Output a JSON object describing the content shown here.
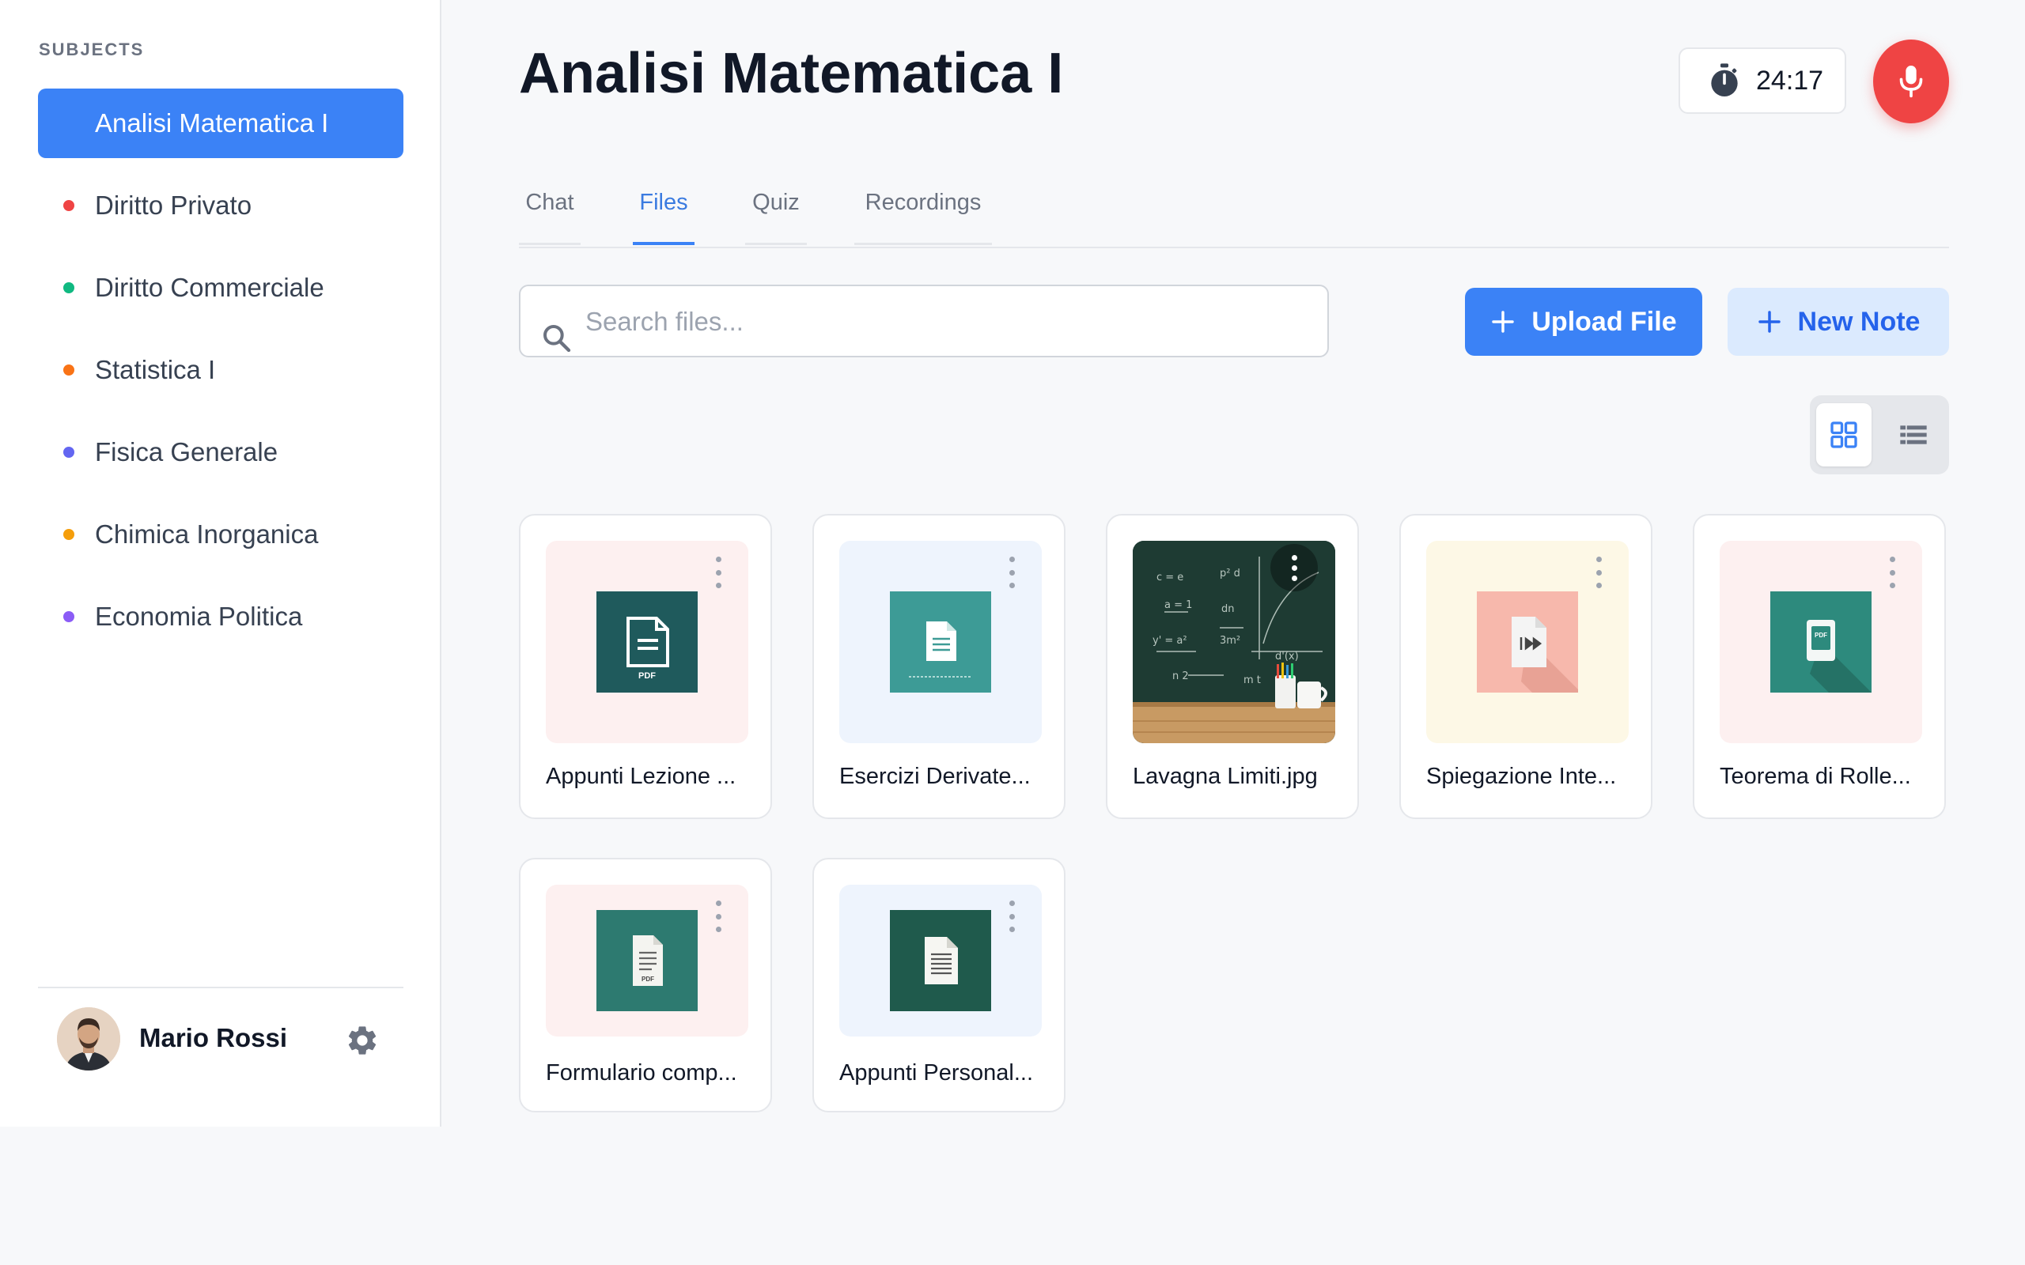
{
  "sidebar": {
    "heading": "SUBJECTS",
    "subjects": [
      {
        "label": "Analisi Matematica I",
        "color": "#3b82f6"
      },
      {
        "label": "Diritto Privato",
        "color": "#ef4444"
      },
      {
        "label": "Diritto Commerciale",
        "color": "#10b981"
      },
      {
        "label": "Statistica I",
        "color": "#f97316"
      },
      {
        "label": "Fisica Generale",
        "color": "#6366f1"
      },
      {
        "label": "Chimica Inorganica",
        "color": "#f59e0b"
      },
      {
        "label": "Economia Politica",
        "color": "#8b5cf6"
      }
    ],
    "user": {
      "name": "Mario Rossi"
    }
  },
  "header": {
    "title": "Analisi Matematica I",
    "timer": "24:17"
  },
  "tabs": [
    {
      "label": "Chat"
    },
    {
      "label": "Files"
    },
    {
      "label": "Quiz"
    },
    {
      "label": "Recordings"
    }
  ],
  "toolbar": {
    "search_placeholder": "Search files...",
    "upload_label": "Upload File",
    "new_note_label": "New Note"
  },
  "files": [
    {
      "name": "Appunti Lezione ...",
      "thumb_bg": "#fdf0f0",
      "icon": "pdf-document-icon"
    },
    {
      "name": "Esercizi Derivate...",
      "thumb_bg": "#eef4fd",
      "icon": "document-icon"
    },
    {
      "name": "Lavagna Limiti.jpg",
      "thumb_bg": "#1f3a33",
      "icon": "chalkboard-image"
    },
    {
      "name": "Spiegazione Inte...",
      "thumb_bg": "#fdf8e6",
      "icon": "audio-file-icon"
    },
    {
      "name": "Teorema di Rolle...",
      "thumb_bg": "#fdf0f0",
      "icon": "pdf-file-icon"
    },
    {
      "name": "Formulario comp...",
      "thumb_bg": "#fdf0f0",
      "icon": "pdf-text-icon"
    },
    {
      "name": "Appunti Personal...",
      "thumb_bg": "#eef4fd",
      "icon": "text-document-icon"
    }
  ],
  "colors": {
    "accent": "#3b82f6",
    "record": "#ef4444"
  }
}
